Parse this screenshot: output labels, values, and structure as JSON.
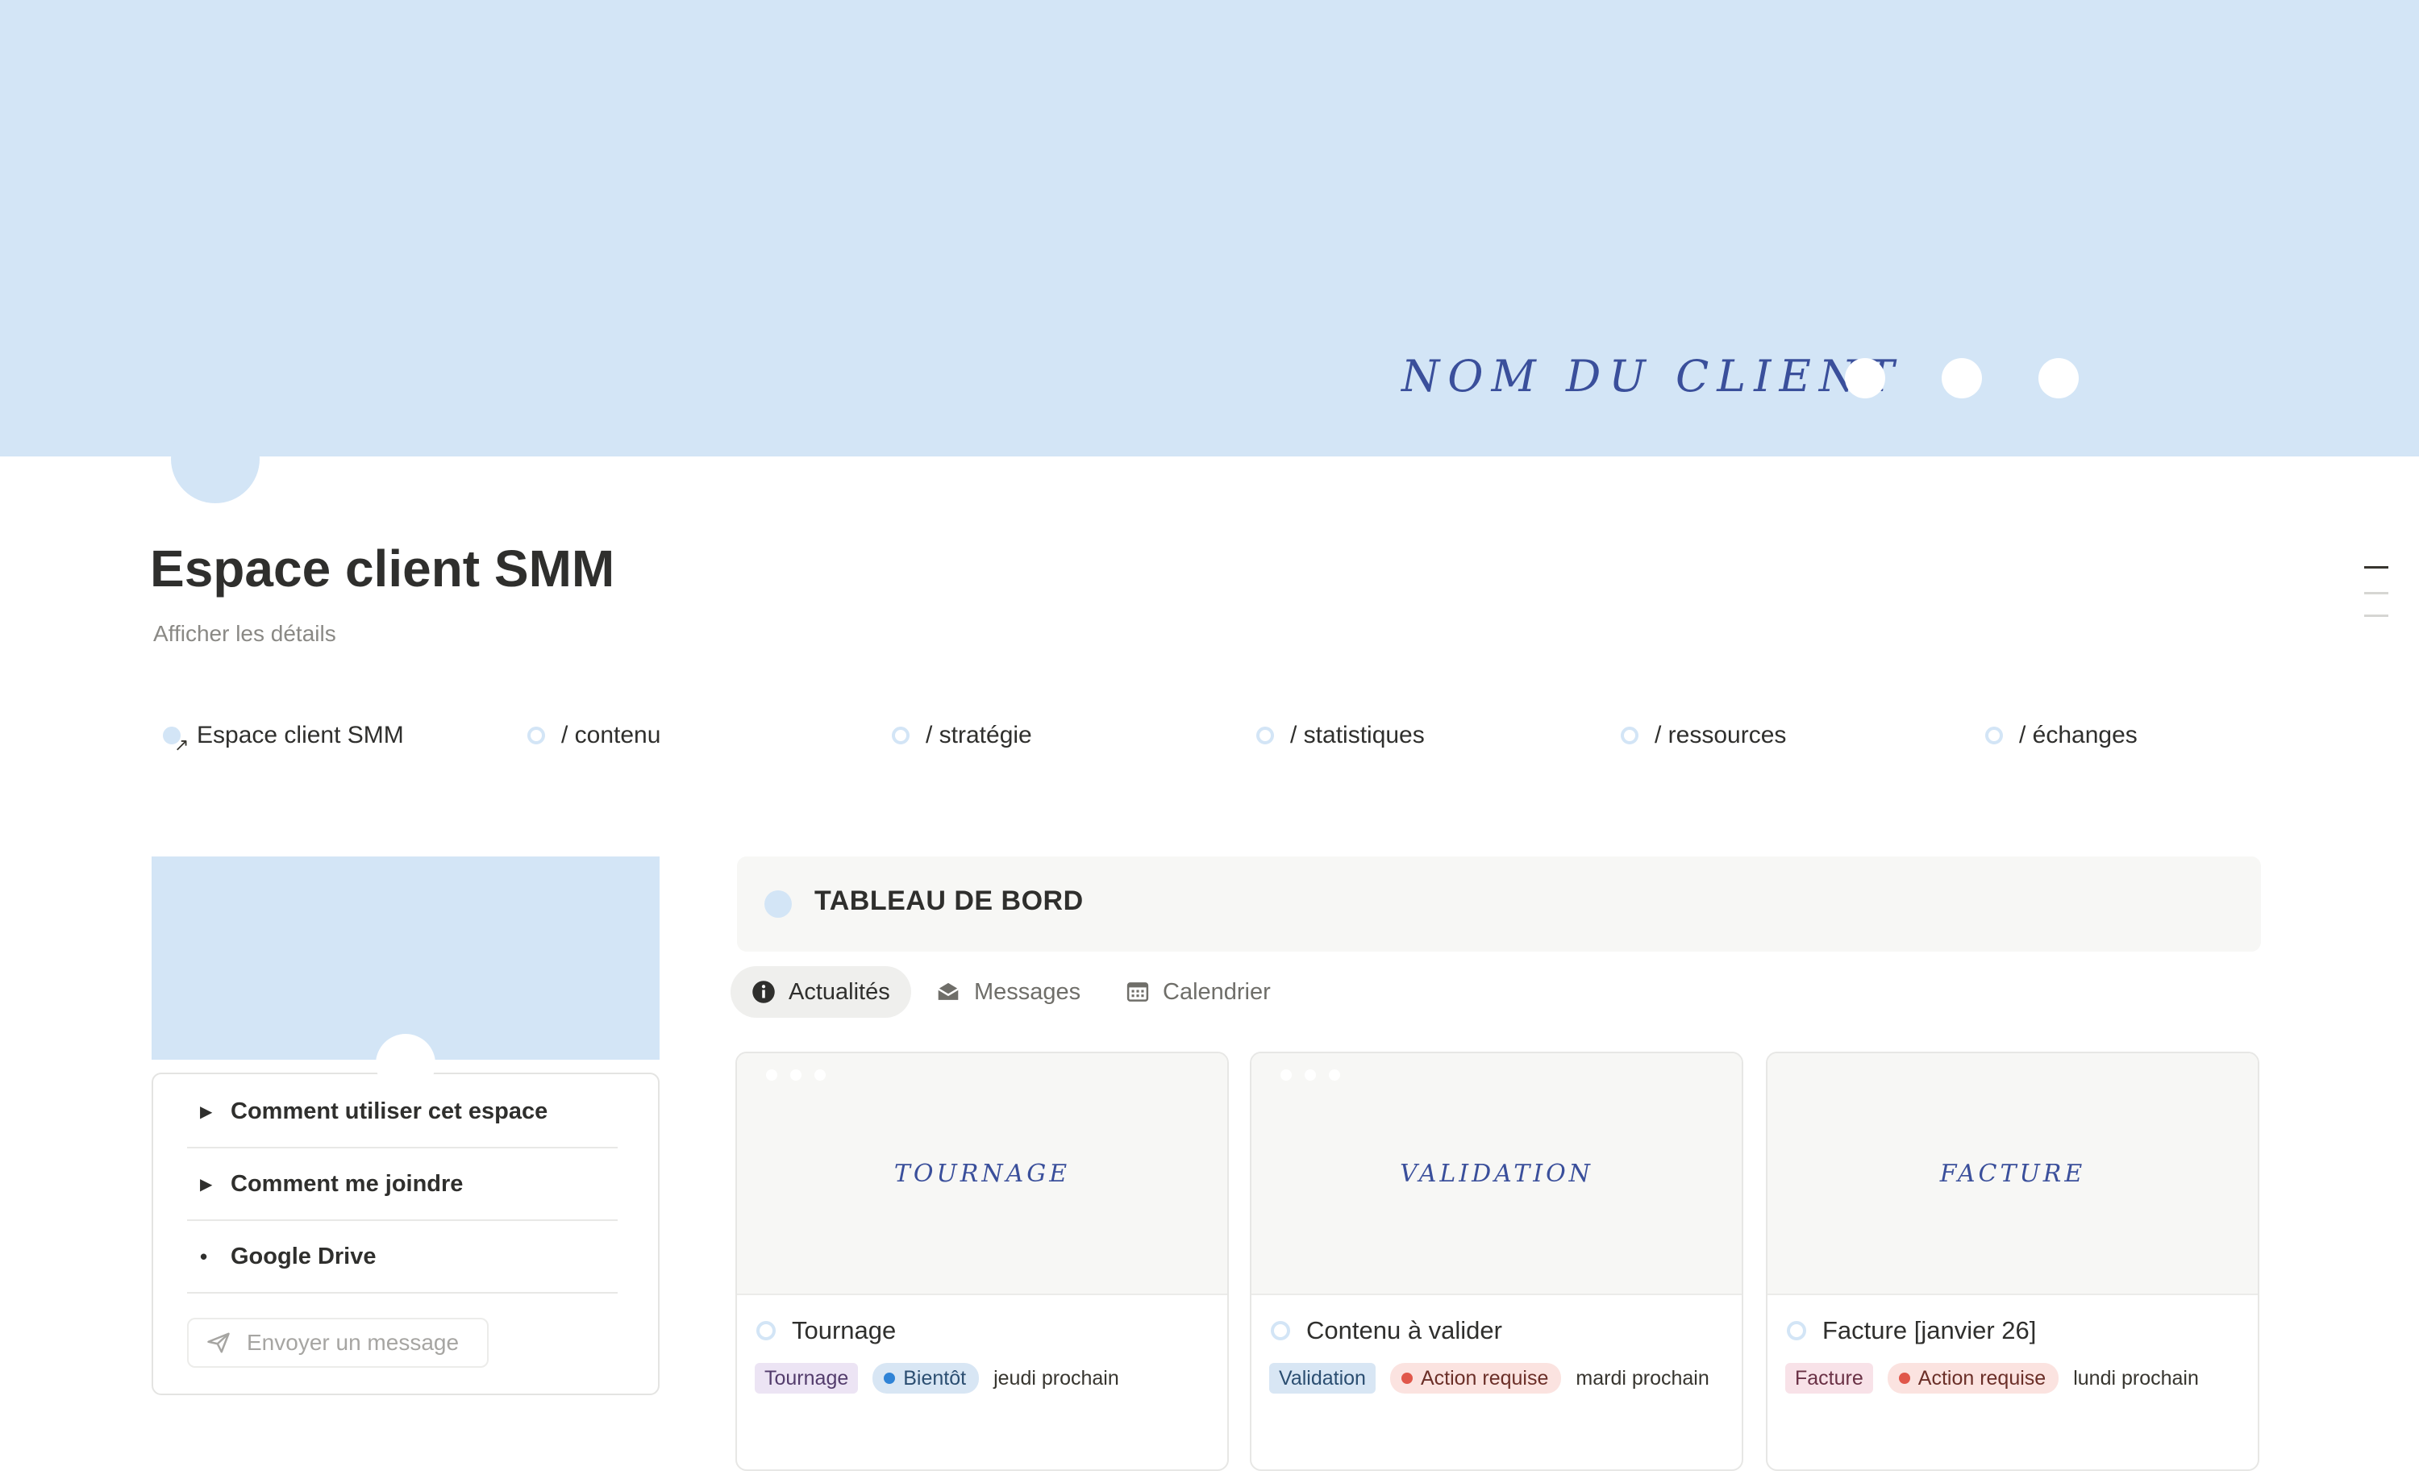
{
  "cover": {
    "client_name": "NOM DU CLIENT",
    "color": "#d3e5f6"
  },
  "page": {
    "title": "Espace client SMM",
    "details_link": "Afficher les détails"
  },
  "nav": [
    {
      "label": "Espace client SMM"
    },
    {
      "label": "/ contenu"
    },
    {
      "label": "/ stratégie"
    },
    {
      "label": "/ statistiques"
    },
    {
      "label": "/ ressources"
    },
    {
      "label": "/ échanges"
    }
  ],
  "sidebar": {
    "items": [
      {
        "label": "Comment utiliser cet espace",
        "icon": "triangle-right-icon"
      },
      {
        "label": "Comment me joindre",
        "icon": "triangle-right-icon"
      },
      {
        "label": "Google Drive",
        "icon": "bullet-icon"
      }
    ],
    "send_message": "Envoyer un message"
  },
  "dashboard": {
    "title": "TABLEAU DE BORD",
    "tabs": [
      {
        "label": "Actualités",
        "icon": "info-icon"
      },
      {
        "label": "Messages",
        "icon": "inbox-icon"
      },
      {
        "label": "Calendrier",
        "icon": "calendar-icon"
      }
    ],
    "cards": [
      {
        "cover_label": "TOURNAGE",
        "title": "Tournage",
        "tag": "Tournage",
        "status": "Bientôt",
        "date": "jeudi prochain"
      },
      {
        "cover_label": "VALIDATION",
        "title": "Contenu à valider",
        "tag": "Validation",
        "status": "Action requise",
        "date": "mardi prochain"
      },
      {
        "cover_label": "FACTURE",
        "title": "Facture [janvier 26]",
        "tag": "Facture",
        "status": "Action requise",
        "date": "lundi prochain"
      }
    ]
  }
}
